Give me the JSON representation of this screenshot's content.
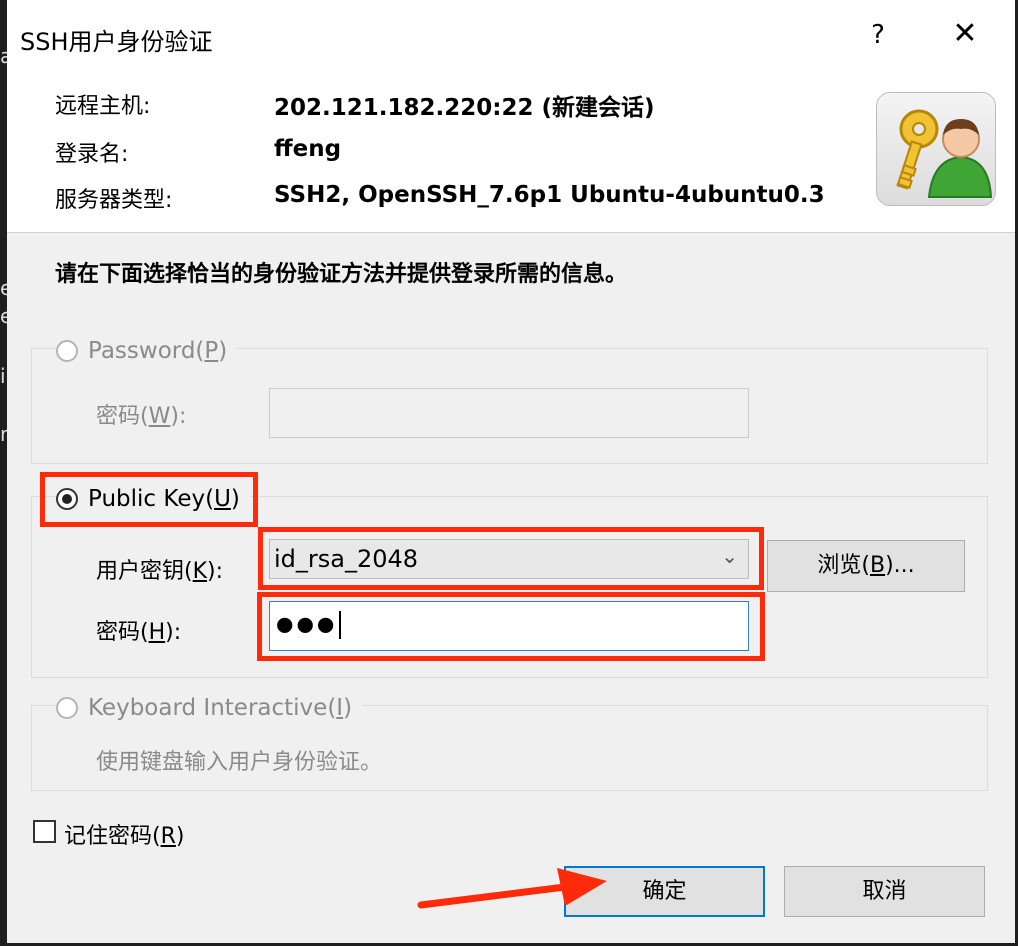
{
  "window": {
    "title": "SSH用户身份验证",
    "help_glyph": "?",
    "close_glyph": "✕"
  },
  "background_edge_glyphs": [
    "a",
    "e",
    "e",
    "i",
    "n"
  ],
  "info": {
    "remote_host_label": "远程主机:",
    "remote_host_value": "202.121.182.220:22 (新建会话)",
    "login_label": "登录名:",
    "login_value": "ffeng",
    "server_type_label": "服务器类型:",
    "server_type_value": "SSH2, OpenSSH_7.6p1 Ubuntu-4ubuntu0.3",
    "icon": "key-user-icon"
  },
  "instruction": "请在下面选择恰当的身份验证方法并提供登录所需的信息。",
  "password_method": {
    "label_pre": "Password(",
    "label_key": "P",
    "label_post": ")",
    "checked": false,
    "enabled": false,
    "pw_label_pre": "密码(",
    "pw_label_key": "W",
    "pw_label_post": "):",
    "pw_value": ""
  },
  "publickey_method": {
    "label_pre": "Public Key(",
    "label_key": "U",
    "label_post": ")",
    "checked": true,
    "key_label_pre": "用户密钥(",
    "key_label_key": "K",
    "key_label_post": "):",
    "key_value": "id_rsa_2048",
    "browse_pre": "浏览(",
    "browse_key": "B",
    "browse_post": ")...",
    "pass_label_pre": "密码(",
    "pass_label_key": "H",
    "pass_label_post": "):",
    "pass_value_masked": "●●●"
  },
  "keyboard_method": {
    "label_pre": "Keyboard Interactive(",
    "label_key": "I",
    "label_post": ")",
    "checked": false,
    "enabled": false,
    "description": "使用键盘输入用户身份验证。"
  },
  "remember": {
    "label_pre": "记住密码(",
    "label_key": "R",
    "label_post": ")",
    "checked": false
  },
  "buttons": {
    "ok": "确定",
    "cancel": "取消"
  },
  "annotation_color": "#ff2a0a"
}
